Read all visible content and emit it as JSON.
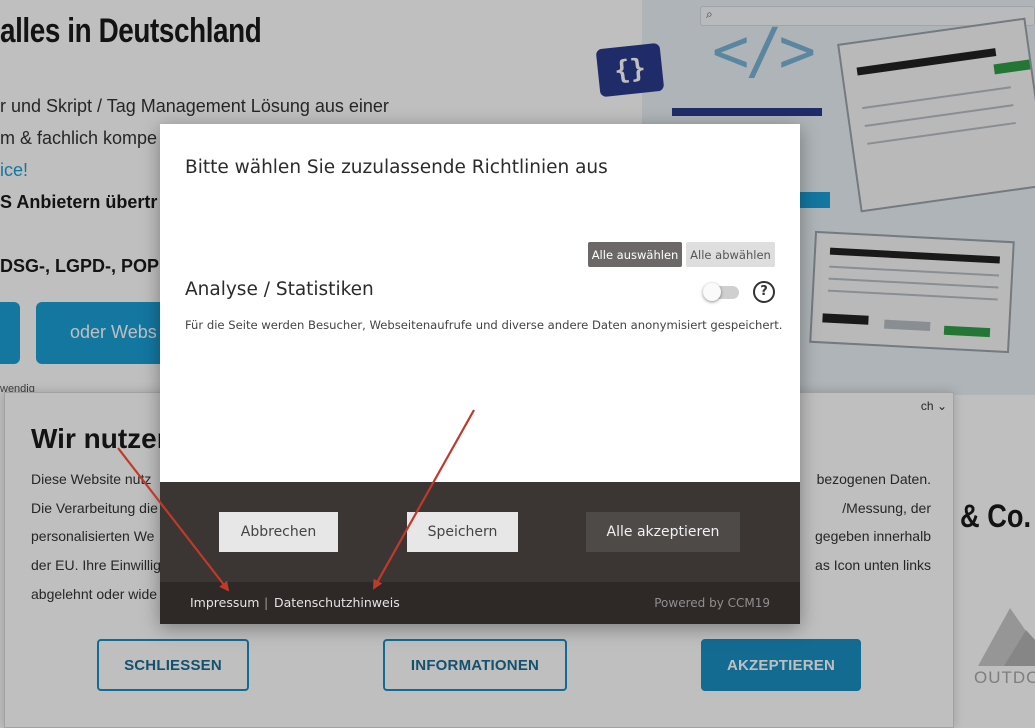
{
  "background_page": {
    "hero_title": "alles in Deutschland",
    "hero_lines": [
      "r und Skript / Tag Management Lösung aus einer",
      "m & fachlich kompe",
      "ice!",
      "S Anbietern übertr",
      "DSG-, LGPD-, POP"
    ],
    "hero_button": "oder Webs",
    "hero_small": "wendig",
    "cookie_banner": {
      "title": "Wir nutzen",
      "text_lines": [
        {
          "left": "Diese Website nutz",
          "right": "bezogenen Daten."
        },
        {
          "left": "Die Verarbeitung die",
          "right": "/Messung, der"
        },
        {
          "left": "personalisierten We",
          "right": "gegeben innerhalb"
        },
        {
          "left": "der EU. Ihre Einwillig",
          "right": "as Icon unten links"
        },
        {
          "left": "abgelehnt oder wide",
          "right": ""
        }
      ],
      "lang_label": "ch",
      "buttons": {
        "close": "SCHLIESSEN",
        "info": "INFORMATIONEN",
        "accept": "AKZEPTIEREN"
      }
    },
    "co_text": "& Co.",
    "outdo_text": "OUTDO"
  },
  "modal": {
    "title": "Bitte wählen Sie zuzulassende Richtlinien aus",
    "select_all": "Alle auswählen",
    "deselect_all": "Alle abwählen",
    "category": {
      "title": "Analyse / Statistiken",
      "toggle_on": false,
      "help_symbol": "?",
      "description": "Für die Seite werden Besucher, Webseitenaufrufe und diverse andere Daten anonymisiert gespeichert."
    },
    "buttons": {
      "cancel": "Abbrechen",
      "save": "Speichern",
      "accept_all": "Alle akzeptieren"
    },
    "footer": {
      "imprint": "Impressum",
      "separator": "|",
      "privacy": "Datenschutzhinweis",
      "powered_by": "Powered by CCM19"
    }
  },
  "colors": {
    "overlay": "rgba(0,0,0,0.25)",
    "footer_dark": "#3b3533",
    "accent_blue": "#1a8fc3",
    "arrow_red": "#c0392b"
  }
}
